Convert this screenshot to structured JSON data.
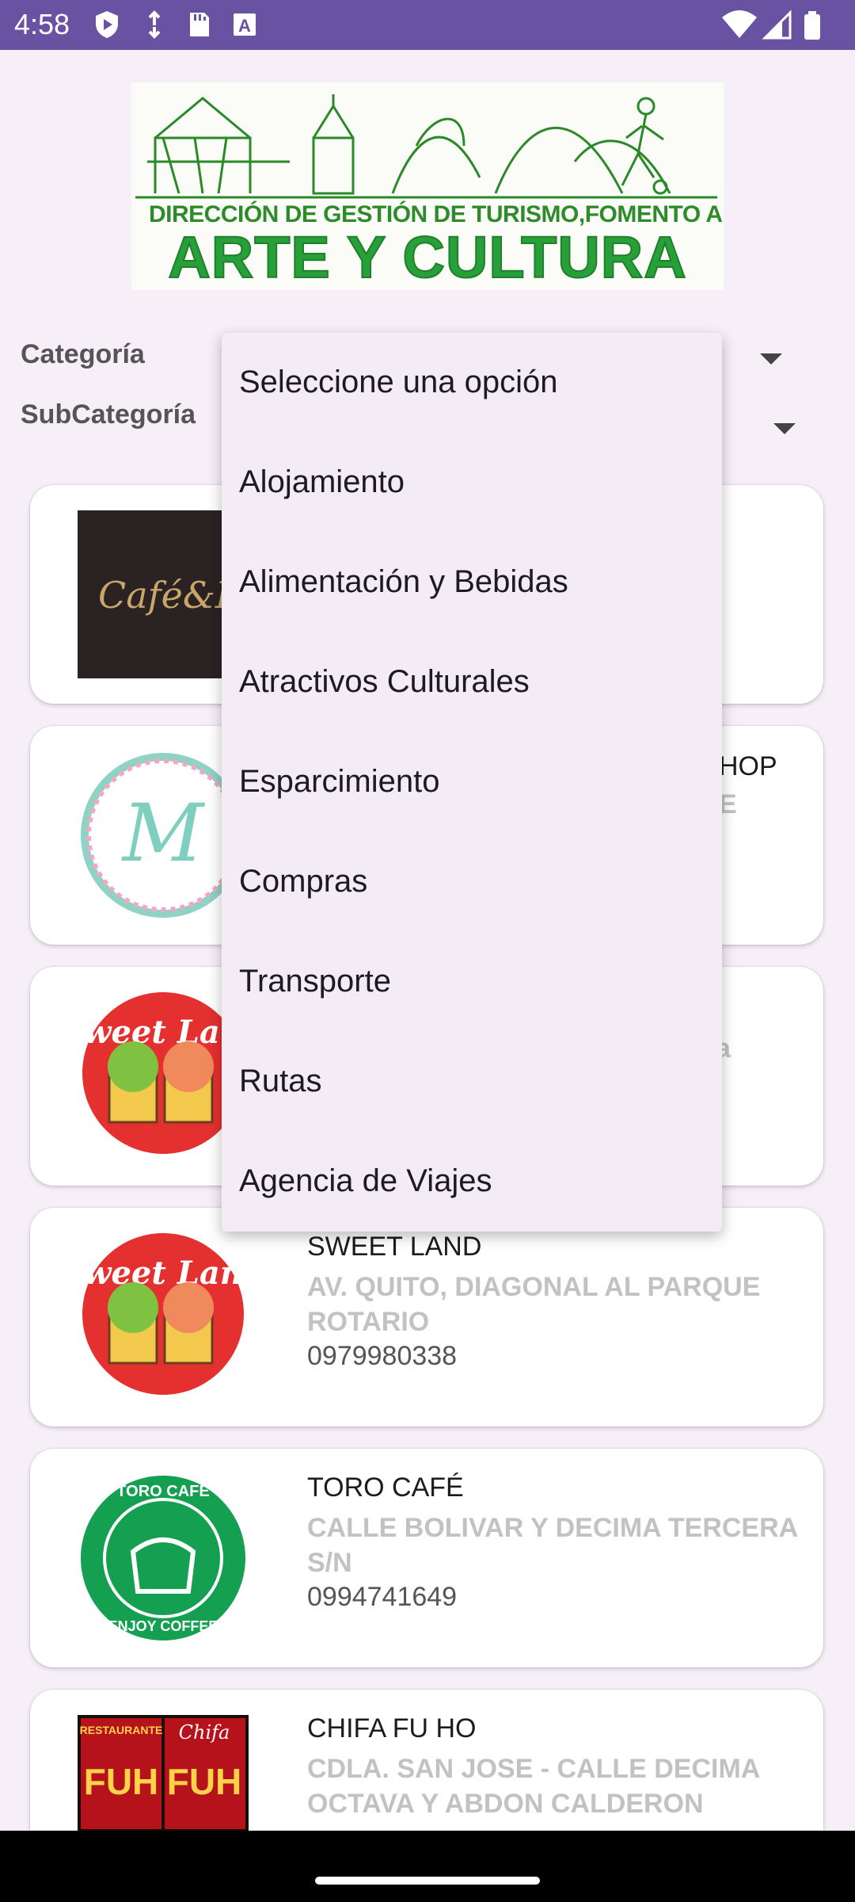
{
  "status_bar": {
    "time": "4:58",
    "left_icons": [
      "play-protect-icon",
      "data-saver-icon",
      "sd-card-icon",
      "font-a-icon"
    ],
    "right_icons": [
      "wifi-icon",
      "signal-icon",
      "battery-icon"
    ],
    "color": "#6a52a3"
  },
  "logo": {
    "line1": "DIRECCIÓN DE GESTIÓN DE TURISMO,FOMENTO AL DEPORTE",
    "line2": "ARTE Y CULTURA"
  },
  "filters": {
    "category_label": "Categoría",
    "subcategory_label": "SubCategoría"
  },
  "dropdown": {
    "options": [
      "Seleccione una opción",
      "Alojamiento",
      "Alimentación y Bebidas",
      "Atractivos Culturales",
      "Esparcimiento",
      "Compras",
      "Transporte",
      "Rutas",
      "Agencia de Viajes"
    ]
  },
  "partial_card_texts": {
    "card2_name_tail": "HOP",
    "card2_addr_tail": "E",
    "card3_addr_tail": "a"
  },
  "cards": [
    {
      "name": "SWEET LAND",
      "address": "AV. QUITO, DIAGONAL  AL PARQUE ROTARIO",
      "phone": "0979980338",
      "logo_icon": "sweet-land-logo-icon"
    },
    {
      "name": "TORO CAFÉ",
      "address": "CALLE BOLIVAR Y DECIMA TERCERA S/N",
      "phone": "0994741649",
      "logo_icon": "toro-cafe-logo-icon"
    },
    {
      "name": "CHIFA FU HO",
      "address": "CDLA. SAN JOSE - CALLE DECIMA OCTAVA Y  ABDON CALDERON",
      "phone": "",
      "logo_icon": "chifa-fu-ho-logo-icon"
    }
  ],
  "logo_texts": {
    "cafe_fina": "Café&Fin",
    "fancy_mint_letter": "M",
    "fancy_mint_ring": "FANCY MINT · COFFEE & CAKE SHOP",
    "sweet_land": "Sweet Land",
    "toro_ring_top": "TORO CAFÉ",
    "toro_ring_bottom": "ENJOY COFFEE",
    "chifa_left": "RESTAURANTE",
    "chifa_right": "Chifa",
    "chifa_fuho": "FUH"
  }
}
